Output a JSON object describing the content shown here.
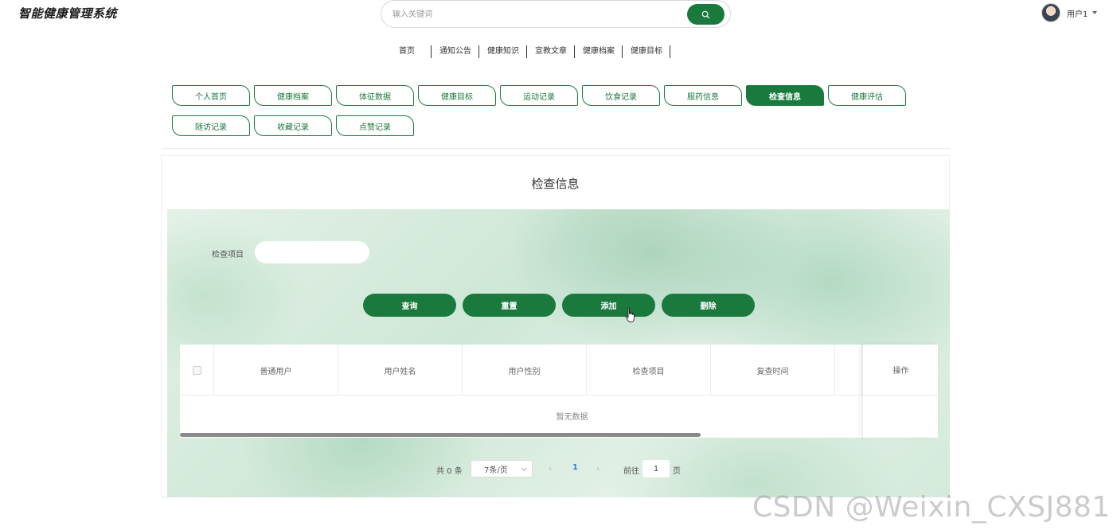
{
  "app": {
    "title": "智能健康管理系统"
  },
  "search": {
    "placeholder": "输入关键词",
    "icon": "search-icon"
  },
  "user": {
    "name": "用户1"
  },
  "nav": [
    "首页",
    "通知公告",
    "健康知识",
    "宣教文章",
    "健康档案",
    "健康目标"
  ],
  "tabs": [
    {
      "label": "个人首页",
      "active": false
    },
    {
      "label": "健康档案",
      "active": false
    },
    {
      "label": "体征数据",
      "active": false
    },
    {
      "label": "健康目标",
      "active": false
    },
    {
      "label": "运动记录",
      "active": false
    },
    {
      "label": "饮食记录",
      "active": false
    },
    {
      "label": "服药信息",
      "active": false
    },
    {
      "label": "检查信息",
      "active": true
    },
    {
      "label": "健康评估",
      "active": false
    },
    {
      "label": "随访记录",
      "active": false
    },
    {
      "label": "收藏记录",
      "active": false
    },
    {
      "label": "点赞记录",
      "active": false
    }
  ],
  "panel": {
    "title": "检查信息",
    "filter": {
      "label": "检查项目",
      "value": ""
    },
    "buttons": {
      "query": "查询",
      "reset": "重置",
      "add": "添加",
      "delete": "删除"
    },
    "table": {
      "columns": [
        "普通用户",
        "用户姓名",
        "用户性别",
        "检查项目",
        "复查时间",
        ""
      ],
      "action_column": "操作",
      "empty_text": "暂无数据"
    },
    "pagination": {
      "total": "共 0 条",
      "page_size": "7条/页",
      "current_page": "1",
      "goto_label": "前往",
      "goto_value": "1",
      "page_unit": "页"
    }
  },
  "watermark": "CSDN @Weixin_CXSJ881",
  "colors": {
    "primary": "#1a7a3e",
    "link": "#2b7fd1"
  }
}
